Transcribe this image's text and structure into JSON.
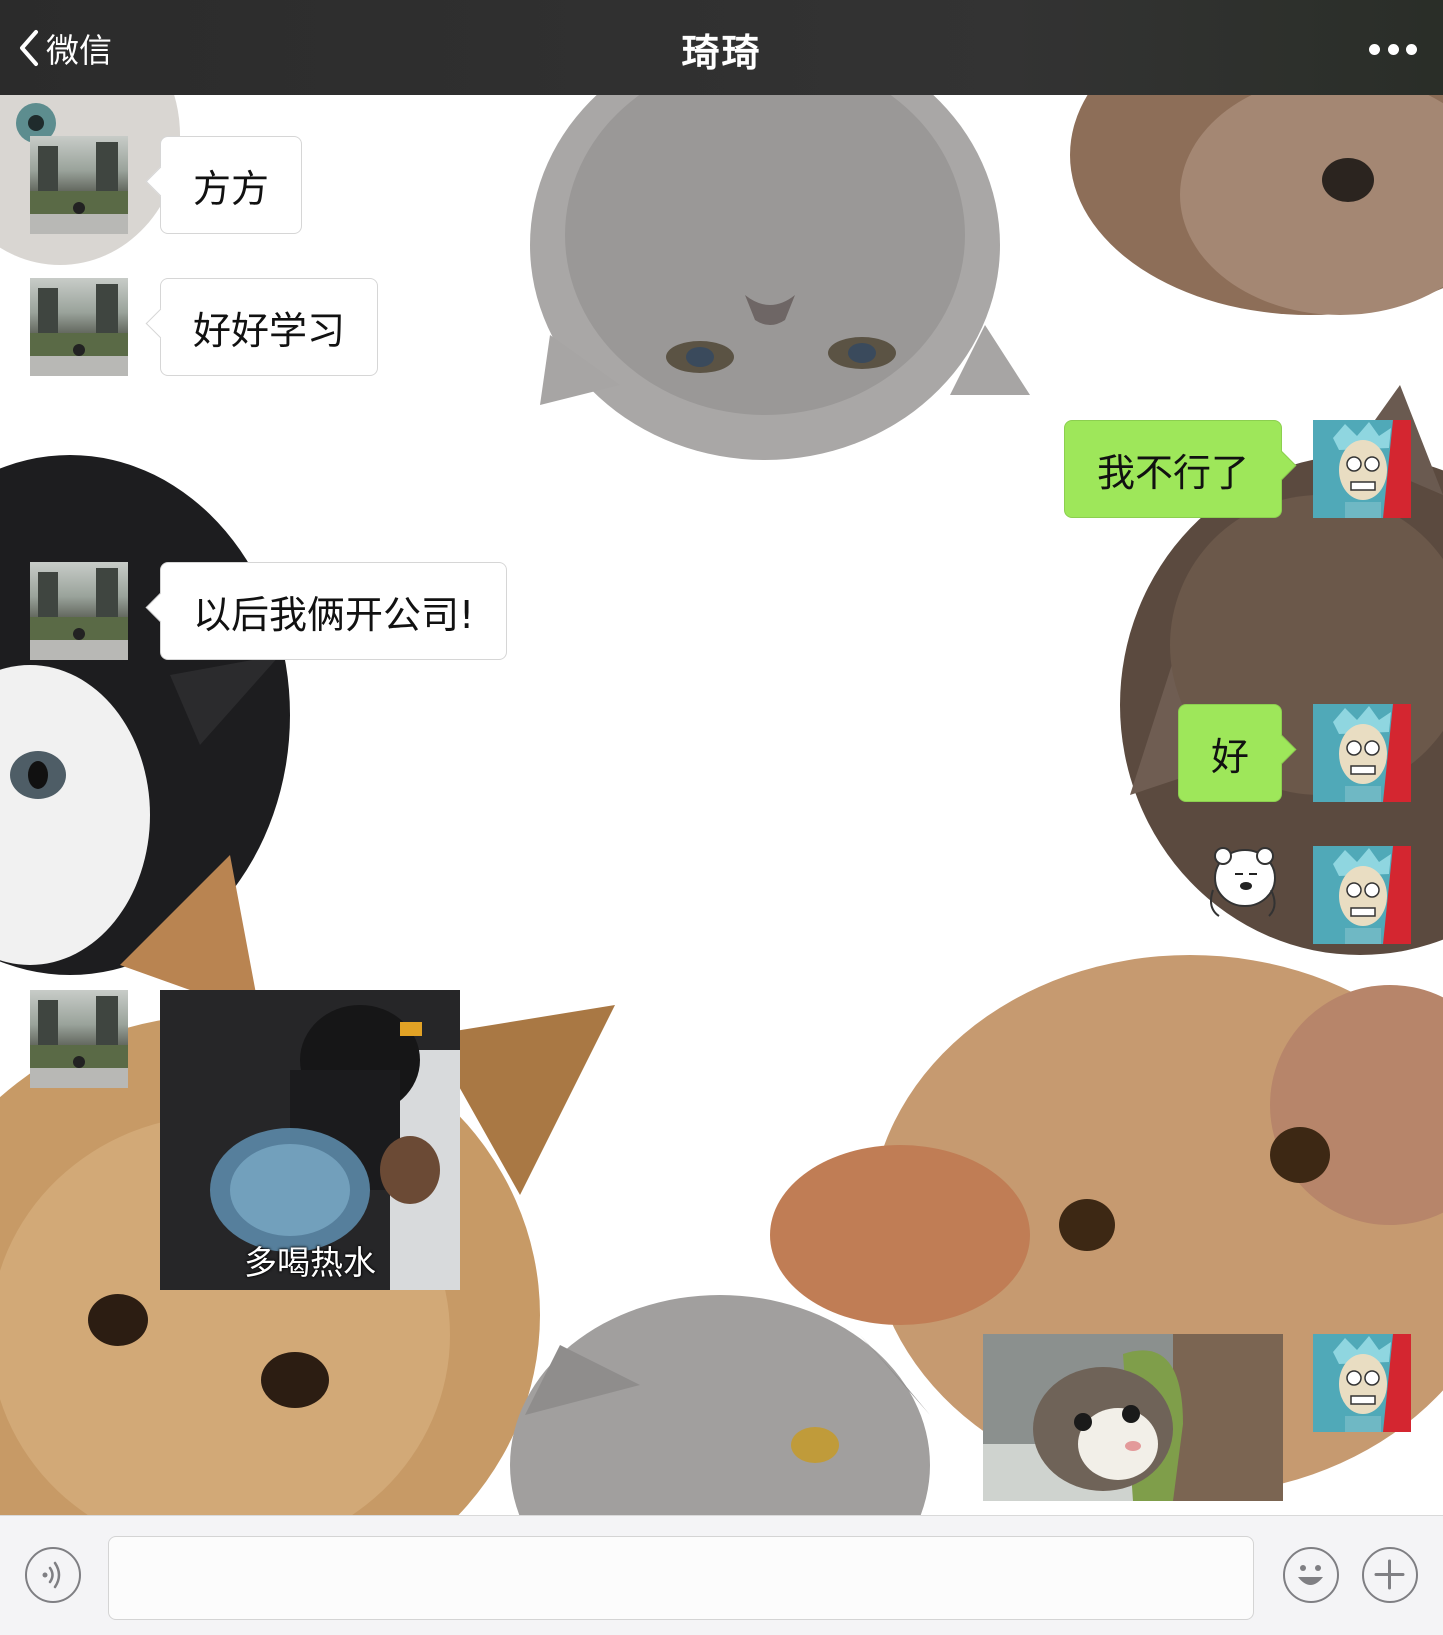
{
  "navbar": {
    "back_label": "微信",
    "title": "琦琦",
    "more_icon": "ellipsis-icon"
  },
  "messages": [
    {
      "side": "left",
      "type": "text",
      "text": "方方"
    },
    {
      "side": "left",
      "type": "text",
      "text": "好好学习"
    },
    {
      "side": "right",
      "type": "text",
      "text": "我不行了"
    },
    {
      "side": "left",
      "type": "text",
      "text": "以后我俩开公司!"
    },
    {
      "side": "right",
      "type": "text",
      "text": "好"
    },
    {
      "side": "right",
      "type": "sticker",
      "sticker": "bear-head-sticker"
    },
    {
      "side": "left",
      "type": "image",
      "caption": "多喝热水"
    },
    {
      "side": "right",
      "type": "image",
      "image": "cat-photo"
    }
  ],
  "colors": {
    "navbar": "#2e2e2e",
    "bubble_sent": "#9ee75a",
    "bubble_received": "#ffffff",
    "avatar_right_bg": "#50a9b8",
    "avatar_right_accent": "#d42630"
  },
  "inputbar": {
    "voice_icon": "voice-icon",
    "input_value": "",
    "emoji_icon": "smiley-icon",
    "plus_icon": "plus-icon"
  }
}
